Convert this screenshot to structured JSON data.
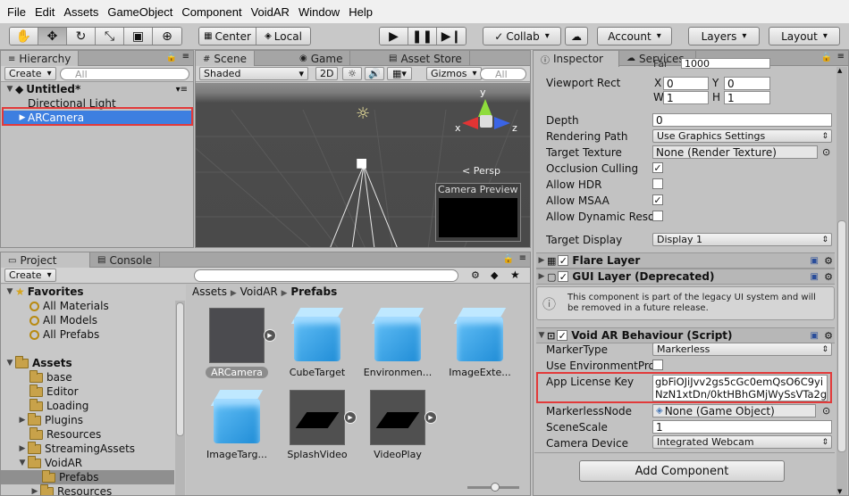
{
  "menu": [
    "File",
    "Edit",
    "Assets",
    "GameObject",
    "Component",
    "VoidAR",
    "Window",
    "Help"
  ],
  "toolbar": {
    "center": "Center",
    "local": "Local",
    "collab": "Collab",
    "account": "Account",
    "layers": "Layers",
    "layout": "Layout"
  },
  "hierarchy": {
    "tab": "Hierarchy",
    "create": "Create",
    "search": "All",
    "scene": "Untitled*",
    "items": [
      "Directional Light",
      "ARCamera"
    ]
  },
  "scene": {
    "tabs": [
      "Scene",
      "Game",
      "Asset Store"
    ],
    "shaded": "Shaded",
    "twod": "2D",
    "gizmos": "Gizmos",
    "search": "All",
    "persp": "Persp",
    "camera_preview": "Camera Preview",
    "axes": {
      "y": "y",
      "x": "x",
      "z": "z"
    }
  },
  "project": {
    "tabs": [
      "Project",
      "Console"
    ],
    "create": "Create",
    "favorites": "Favorites",
    "fav_items": [
      "All Materials",
      "All Models",
      "All Prefabs"
    ],
    "assets": "Assets",
    "asset_folders": [
      "base",
      "Editor",
      "Loading",
      "Plugins",
      "Resources",
      "StreamingAssets",
      "VoidAR",
      "Prefabs",
      "Resources"
    ],
    "breadcrumb": [
      "Assets",
      "VoidAR",
      "Prefabs"
    ],
    "grid": [
      "ARCamera",
      "CubeTarget",
      "Environmen...",
      "ImageExte...",
      "ImageTarg...",
      "SplashVideo",
      "VideoPlay"
    ]
  },
  "inspector": {
    "tabs": [
      "Inspector",
      "Services"
    ],
    "far_label": "Far",
    "far_value": "1000",
    "viewport": {
      "label": "Viewport Rect",
      "x_label": "X",
      "x": "0",
      "y_label": "Y",
      "y": "0",
      "w_label": "W",
      "w": "1",
      "h_label": "H",
      "h": "1"
    },
    "depth": {
      "label": "Depth",
      "value": "0"
    },
    "rendering_path": {
      "label": "Rendering Path",
      "value": "Use Graphics Settings"
    },
    "target_texture": {
      "label": "Target Texture",
      "value": "None (Render Texture)"
    },
    "occlusion": {
      "label": "Occlusion Culling",
      "checked": "✓"
    },
    "hdr": {
      "label": "Allow HDR"
    },
    "msaa": {
      "label": "Allow MSAA",
      "checked": "✓"
    },
    "dynres": {
      "label": "Allow Dynamic Reso"
    },
    "target_display": {
      "label": "Target Display",
      "value": "Display 1"
    },
    "flare": "Flare Layer",
    "gui": "GUI Layer (Deprecated)",
    "gui_msg": "This component is part of the legacy UI system and will be removed in a future release.",
    "voidar": "Void AR Behaviour (Script)",
    "marker_type": {
      "label": "MarkerType",
      "value": "Markerless"
    },
    "use_env": {
      "label": "Use EnvironmentPro"
    },
    "license": {
      "label": "App License Key",
      "line1": "gbFiOJiJvv2gs5cGc0emQsO6C9yi",
      "line2": "NzN1xtDn/0ktHBhGMjWySsVTa2g"
    },
    "markerless_node": {
      "label": "MarkerlessNode",
      "value": "None (Game Object)"
    },
    "scene_scale": {
      "label": "SceneScale",
      "value": "1"
    },
    "camera_device": {
      "label": "Camera Device",
      "value": "Integrated Webcam"
    },
    "add_component": "Add Component"
  },
  "colors": {
    "highlight": "#e23a3a",
    "selection": "#3d7fe0"
  }
}
